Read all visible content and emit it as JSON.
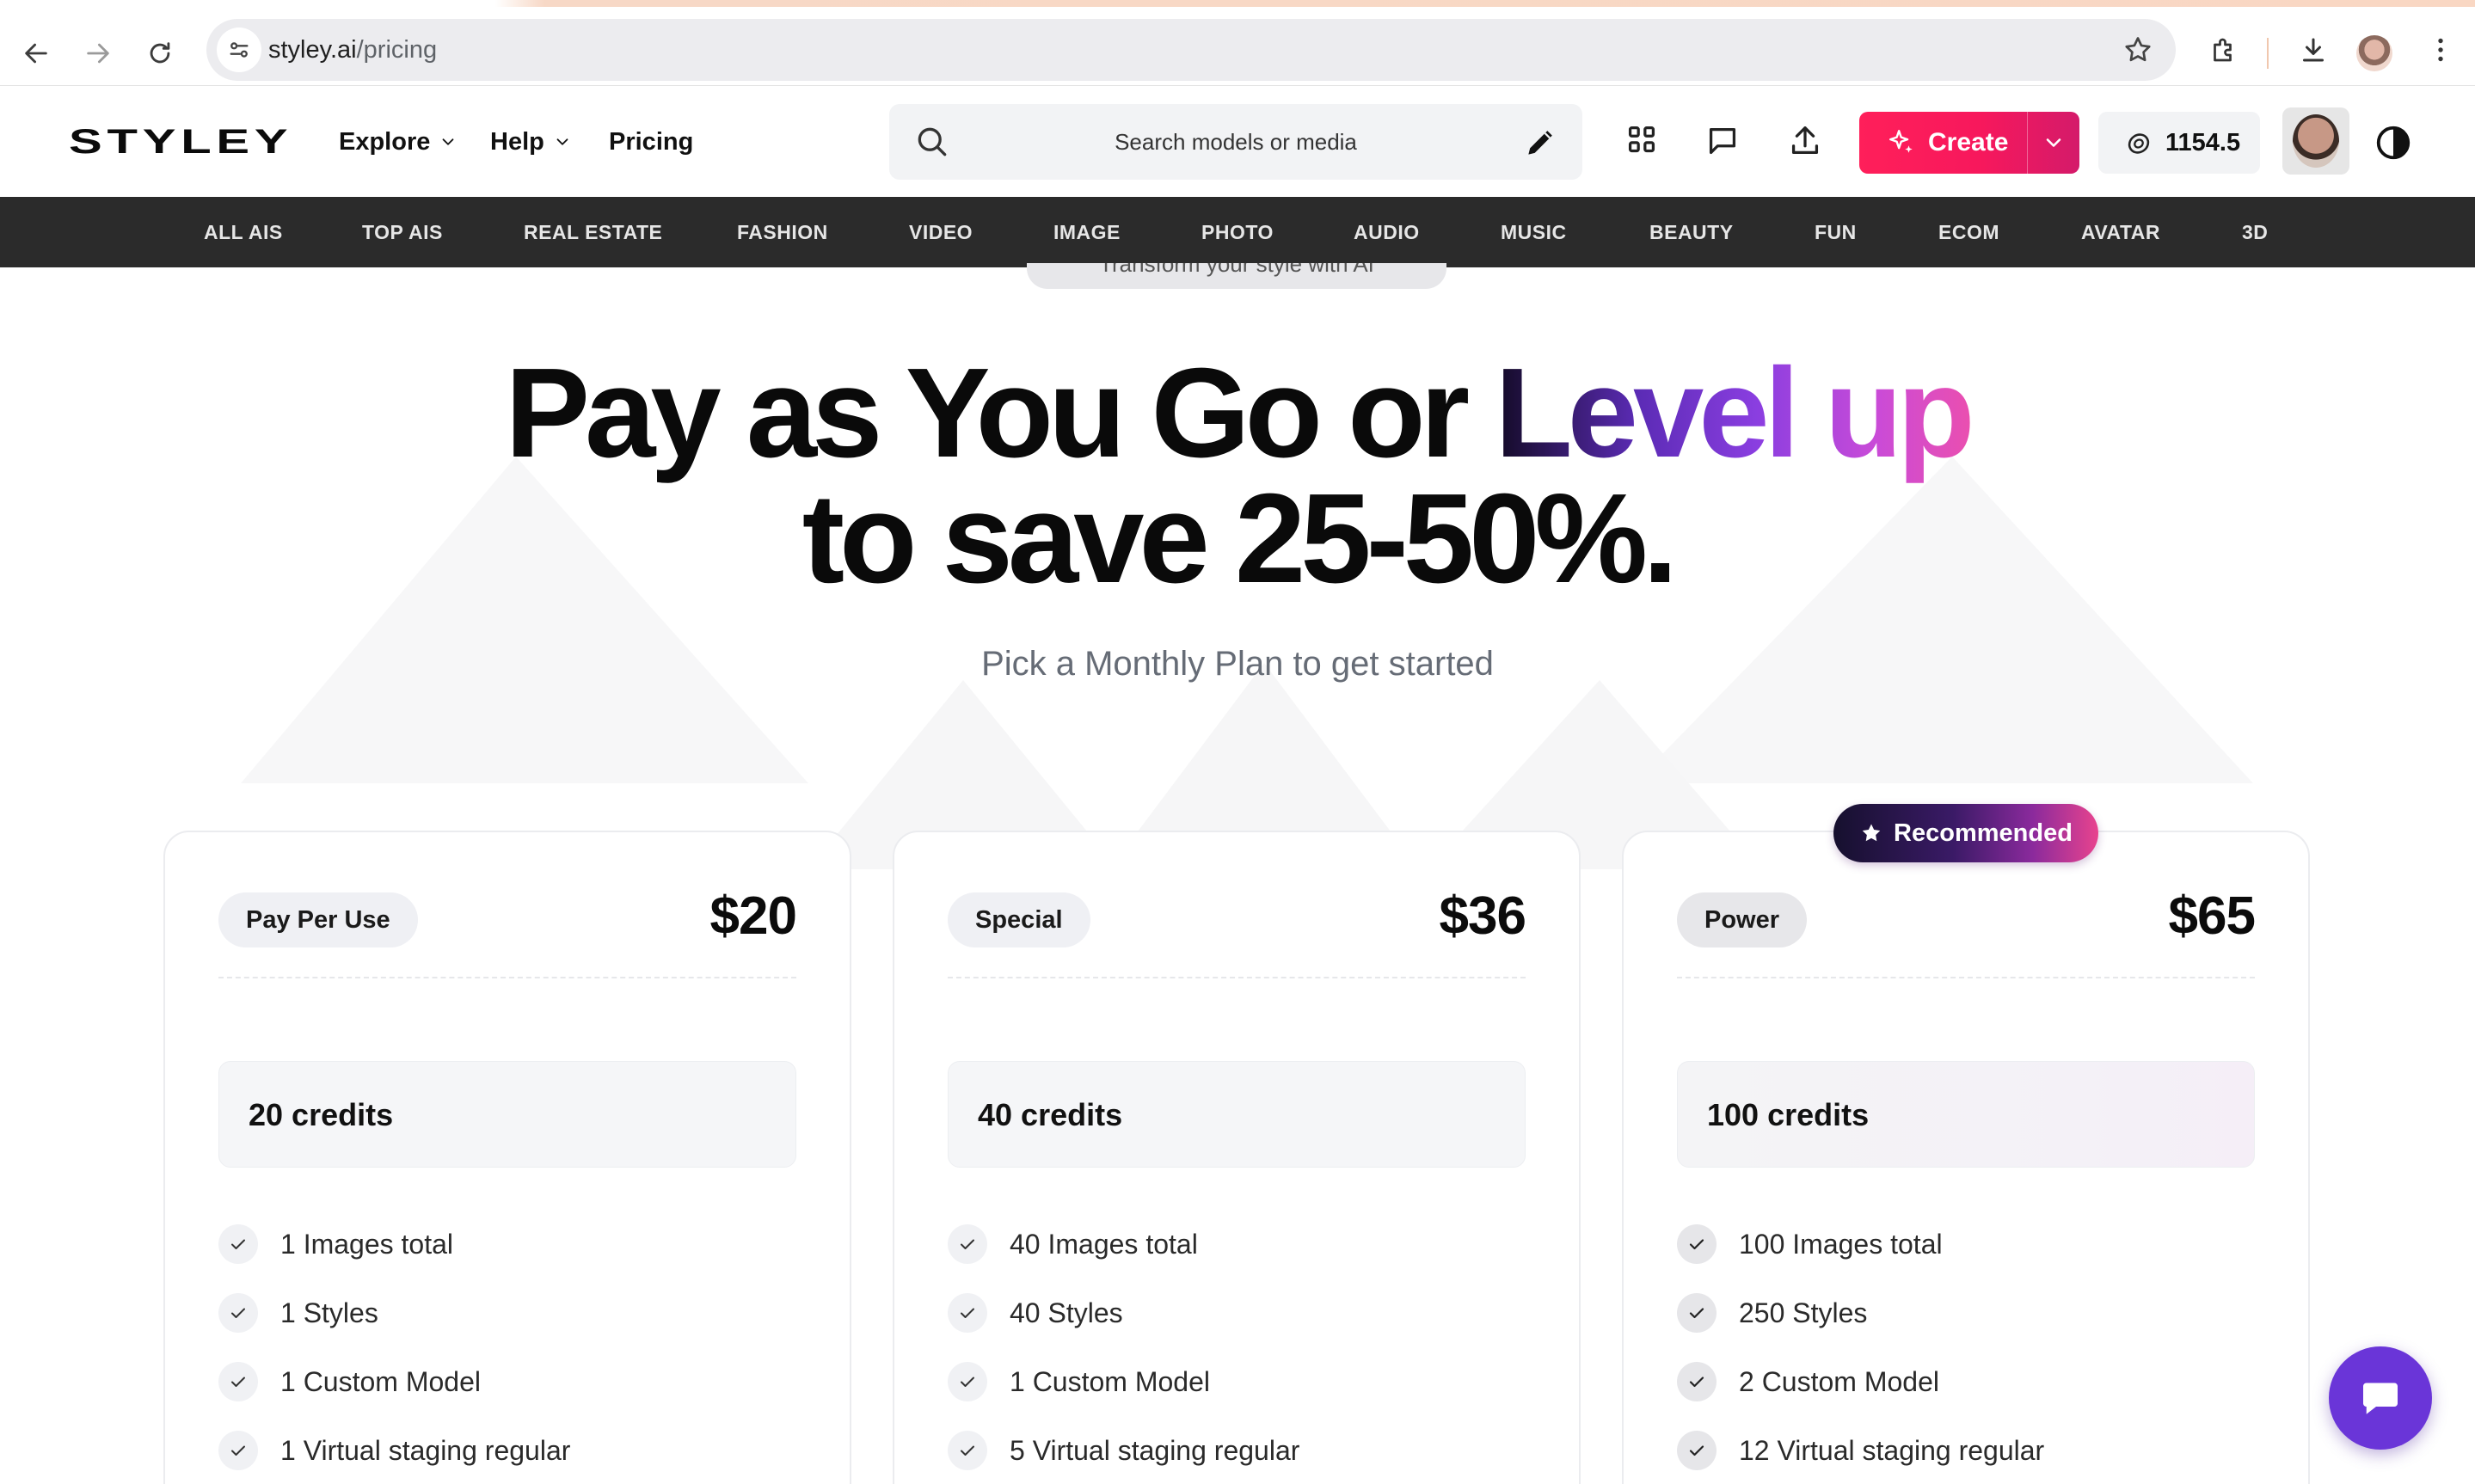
{
  "browser": {
    "url_host": "styley.ai",
    "url_path": "/pricing"
  },
  "header": {
    "logo": "STYLEY",
    "nav": {
      "explore": "Explore",
      "help": "Help",
      "pricing": "Pricing"
    },
    "search": {
      "placeholder": "Search models or media"
    },
    "create_label": "Create",
    "credits_balance": "1154.5"
  },
  "categories": [
    "ALL AIS",
    "TOP AIS",
    "REAL ESTATE",
    "FASHION",
    "VIDEO",
    "IMAGE",
    "PHOTO",
    "AUDIO",
    "MUSIC",
    "BEAUTY",
    "FUN",
    "ECOM",
    "AVATAR",
    "3D"
  ],
  "hero": {
    "pill_text": "Transform your style with AI",
    "title_plain": "Pay as You Go or ",
    "title_gradient": "Level up",
    "title_line2": "to save 25-50%.",
    "subtitle": "Pick a Monthly Plan to get started"
  },
  "recommended_badge": "Recommended",
  "plans": [
    {
      "name": "Pay Per Use",
      "price": "$20",
      "credits": "20 credits",
      "features": [
        "1 Images total",
        "1 Styles",
        "1 Custom Model",
        "1 Virtual staging regular"
      ]
    },
    {
      "name": "Special",
      "price": "$36",
      "credits": "40 credits",
      "features": [
        "40 Images total",
        "40 Styles",
        "1 Custom Model",
        "5 Virtual staging regular"
      ]
    },
    {
      "name": "Power",
      "price": "$65",
      "credits": "100 credits",
      "features": [
        "100 Images total",
        "250 Styles",
        "2 Custom Model",
        "12 Virtual staging regular"
      ]
    }
  ],
  "colors": {
    "create_button": "#ff1f5a",
    "category_bar": "#2b2b2b",
    "chat_button": "#6a35d8",
    "gradient_start": "#120a24",
    "gradient_end": "#ea4fb0"
  }
}
